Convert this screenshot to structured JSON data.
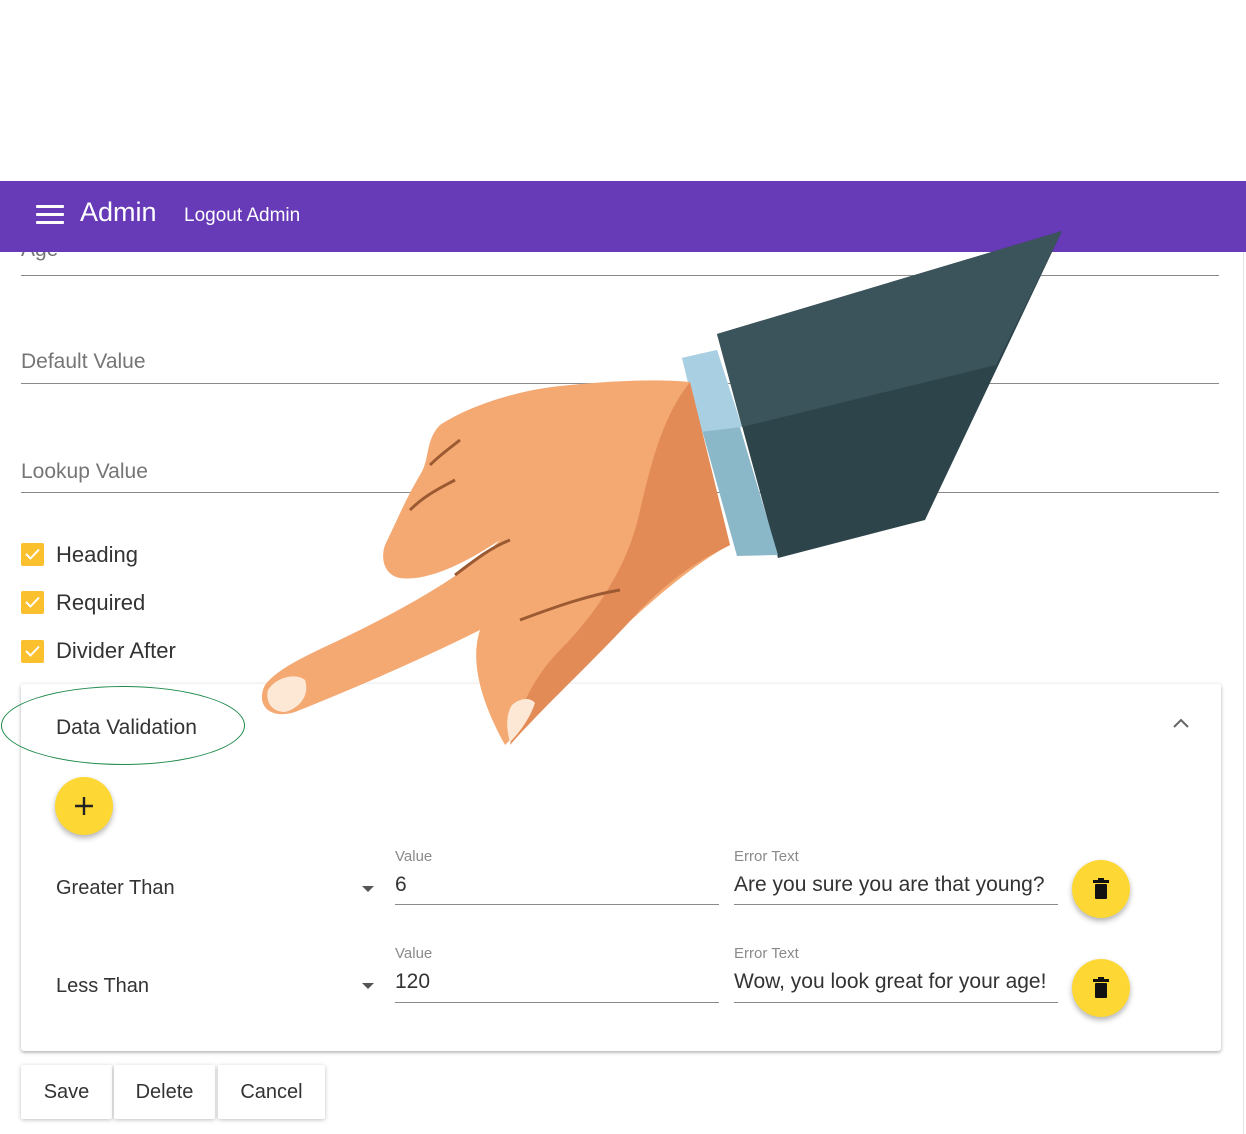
{
  "appbar": {
    "title": "Admin",
    "logout_label": "Logout Admin",
    "color": "#673ab7"
  },
  "form": {
    "name_value": "Age",
    "default_value_label": "Default Value",
    "lookup_value_label": "Lookup Value",
    "checkboxes": [
      {
        "label": "Heading",
        "checked": true
      },
      {
        "label": "Required",
        "checked": true
      },
      {
        "label": "Divider After",
        "checked": true
      }
    ]
  },
  "validation": {
    "title": "Data Validation",
    "rules": [
      {
        "operator": "Greater Than",
        "value_label": "Value",
        "value": "6",
        "error_label": "Error Text",
        "error_text": "Are you sure you are that young?"
      },
      {
        "operator": "Less Than",
        "value_label": "Value",
        "value": "120",
        "error_label": "Error Text",
        "error_text": "Wow, you look great for your age!"
      }
    ]
  },
  "actions": {
    "save": "Save",
    "delete": "Delete",
    "cancel": "Cancel"
  },
  "colors": {
    "accent": "#fdd835",
    "checkbox": "#fbc02d",
    "annotation_oval": "#1f8a4c"
  }
}
